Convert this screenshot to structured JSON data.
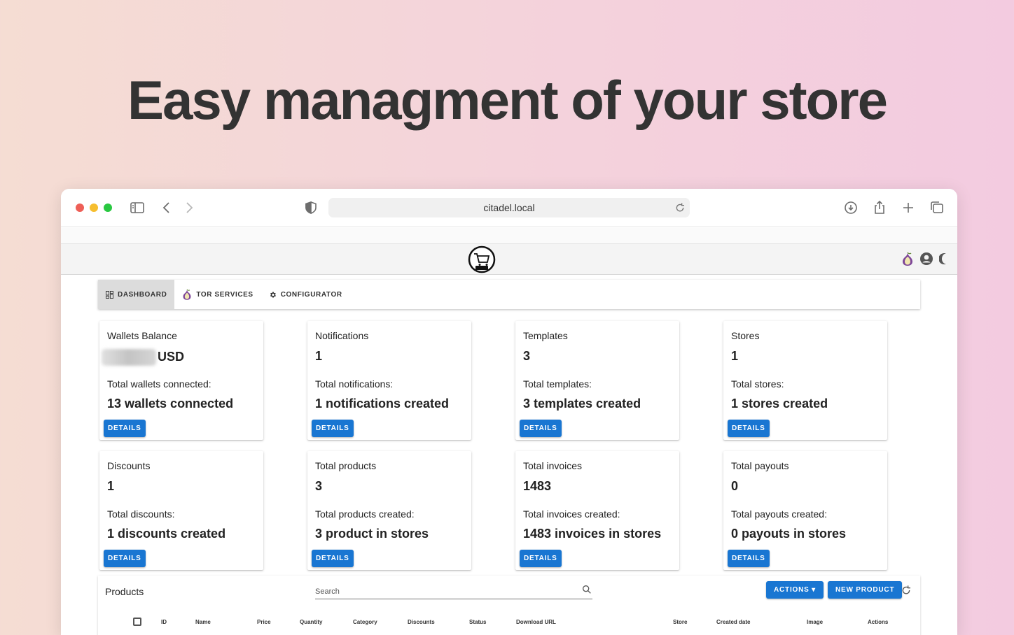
{
  "headline": "Easy managment of your store",
  "browser": {
    "url": "citadel.local"
  },
  "nav": {
    "tabs": [
      {
        "label": "DASHBOARD",
        "icon": "dashboard-icon"
      },
      {
        "label": "TOR SERVICES",
        "icon": "tor-onion-icon"
      },
      {
        "label": "CONFIGURATOR",
        "icon": "gear-icon"
      }
    ]
  },
  "cards": [
    {
      "title": "Wallets Balance",
      "value": "USD",
      "sub": "Total wallets connected:",
      "big": "13 wallets connected",
      "button": "DETAILS"
    },
    {
      "title": "Notifications",
      "value": "1",
      "sub": "Total notifications:",
      "big": "1 notifications created",
      "button": "DETAILS"
    },
    {
      "title": "Templates",
      "value": "3",
      "sub": "Total templates:",
      "big": "3 templates created",
      "button": "DETAILS"
    },
    {
      "title": "Stores",
      "value": "1",
      "sub": "Total stores:",
      "big": "1 stores created",
      "button": "DETAILS"
    },
    {
      "title": "Discounts",
      "value": "1",
      "sub": "Total discounts:",
      "big": "1 discounts created",
      "button": "DETAILS"
    },
    {
      "title": "Total products",
      "value": "3",
      "sub": "Total products created:",
      "big": "3 product in stores",
      "button": "DETAILS"
    },
    {
      "title": "Total invoices",
      "value": "1483",
      "sub": "Total invoices created:",
      "big": "1483 invoices in stores",
      "button": "DETAILS"
    },
    {
      "title": "Total payouts",
      "value": "0",
      "sub": "Total payouts created:",
      "big": "0 payouts in stores",
      "button": "DETAILS"
    }
  ],
  "products": {
    "title": "Products",
    "search_placeholder": "Search",
    "actions_label": "ACTIONS ▾",
    "new_product_label": "NEW PRODUCT",
    "columns": [
      "ID",
      "Name",
      "Price",
      "Quantity",
      "Category",
      "Discounts",
      "Status",
      "Download URL",
      "Store",
      "Created date",
      "Image",
      "Actions"
    ]
  },
  "colors": {
    "accent": "#1976d2",
    "headline": "#333333"
  }
}
